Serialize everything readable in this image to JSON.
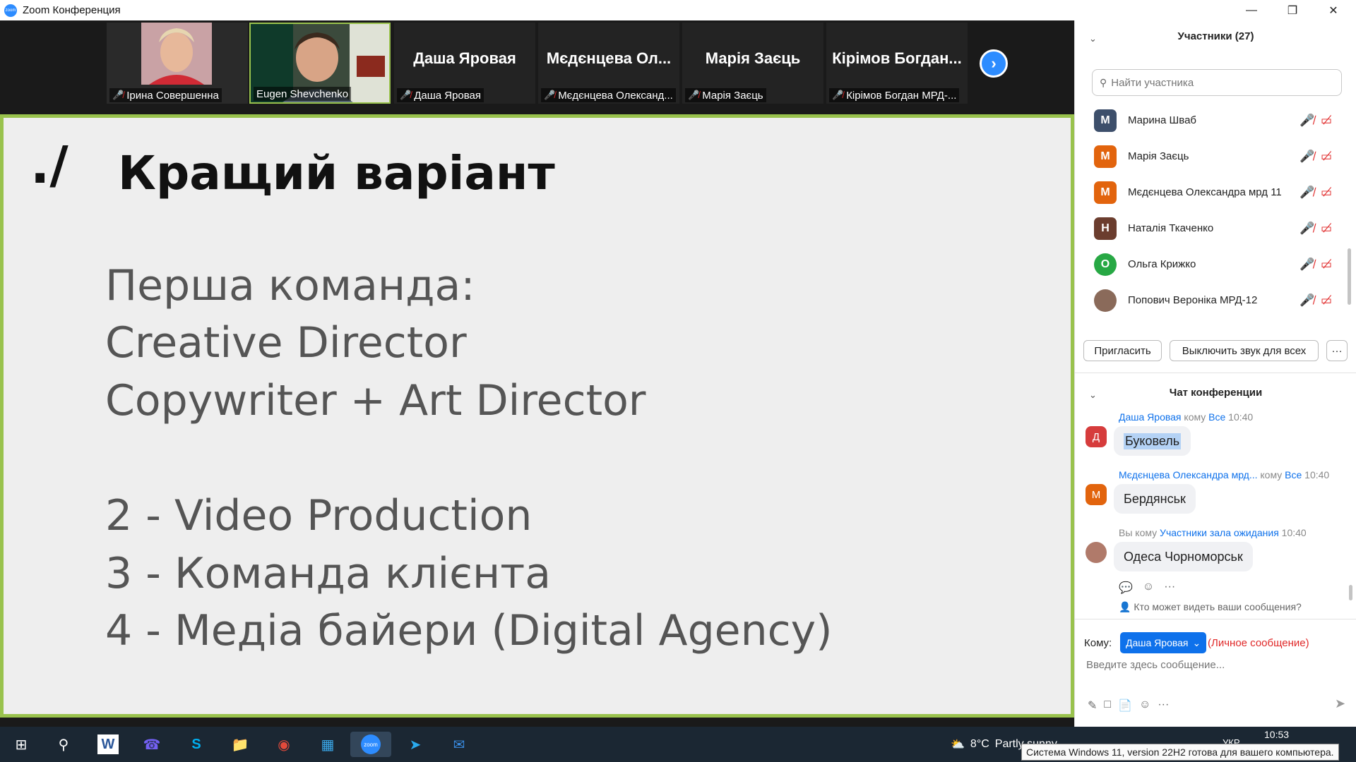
{
  "window": {
    "title": "Zoom Конференция",
    "controls": [
      "minimize-icon",
      "restore-icon",
      "close-icon"
    ]
  },
  "video_strip": {
    "tiles": [
      {
        "name": "Ірина Совершенна",
        "display": "photo",
        "muted": true
      },
      {
        "name": "Eugen Shevchenko",
        "display": "photo",
        "muted": false,
        "active_speaker": true
      },
      {
        "big_name": "Даша Яровая",
        "name": "Даша Яровая",
        "muted": true
      },
      {
        "big_name": "Мєдєнцева Ол...",
        "name": "Мєдєнцева Олександ...",
        "muted": true
      },
      {
        "big_name": "Марія Заєць",
        "name": "Марія Заєць",
        "muted": true
      },
      {
        "big_name": "Кірімов Богдан...",
        "name": "Кірімов Богдан МРД-...",
        "muted": true
      }
    ],
    "next_icon": "chevron-right-icon"
  },
  "slide": {
    "logo": "./",
    "heading": "Кращий варіант",
    "lines": [
      "Перша команда:",
      "Creative Director",
      "Copywriter + Art Director",
      "2 - Video Production",
      "3 - Команда клієнта",
      "4 - Медіа байери (Digital Agency)"
    ]
  },
  "participants": {
    "header": "Участники (27)",
    "search_placeholder": "Найти участника",
    "list": [
      {
        "initial": "M",
        "name": "Марина Шваб",
        "color": "#3d4f6b"
      },
      {
        "initial": "M",
        "name": "Марія Заєць",
        "color": "#e2640d"
      },
      {
        "initial": "M",
        "name": "Мєдєнцева Олександра мрд 11",
        "color": "#e2640d"
      },
      {
        "initial": "Н",
        "name": "Наталія Ткаченко",
        "color": "#6b3d2e"
      },
      {
        "initial": "О",
        "name": "Ольга Крижко",
        "color": "#27a844"
      },
      {
        "initial": "",
        "name": "Попович Вероніка МРД-12",
        "color": "#8a6a5a"
      }
    ],
    "invite_label": "Пригласить",
    "mute_all_label": "Выключить звук для всех",
    "more_label": "···"
  },
  "chat": {
    "header": "Чат конференции",
    "messages": [
      {
        "avatar": "Д",
        "avatar_color": "#d63c3c",
        "sender": "Даша Яровая",
        "to_word": "кому",
        "recipient": "Все",
        "time": "10:40",
        "text": "Буковель",
        "highlighted": true
      },
      {
        "avatar": "M",
        "avatar_color": "#e2640d",
        "sender": "Мєдєнцева Олександра мрд...",
        "to_word": "кому",
        "recipient": "Все",
        "time": "10:40",
        "text": "Бердянськ",
        "highlighted": false
      },
      {
        "avatar": "",
        "avatar_color": "#b07a6a",
        "sender": "Вы",
        "to_word": "кому",
        "recipient": "Участники зала ожидания",
        "time": "10:40",
        "text": "Одеса Чорноморськ",
        "highlighted": false
      }
    ],
    "who_can_see": "Кто может видеть ваши сообщения?",
    "to_label": "Кому:",
    "to_value": "Даша Яровая",
    "private_label": "(Личное сообщение)",
    "compose_placeholder": "Введите здесь сообщение..."
  },
  "taskbar": {
    "weather_temp": "8°C",
    "weather_text": "Partly sunny",
    "lang": "УКР",
    "time": "10:53",
    "tooltip": "Система Windows 11, version 22H2 готова для вашего компьютера."
  }
}
